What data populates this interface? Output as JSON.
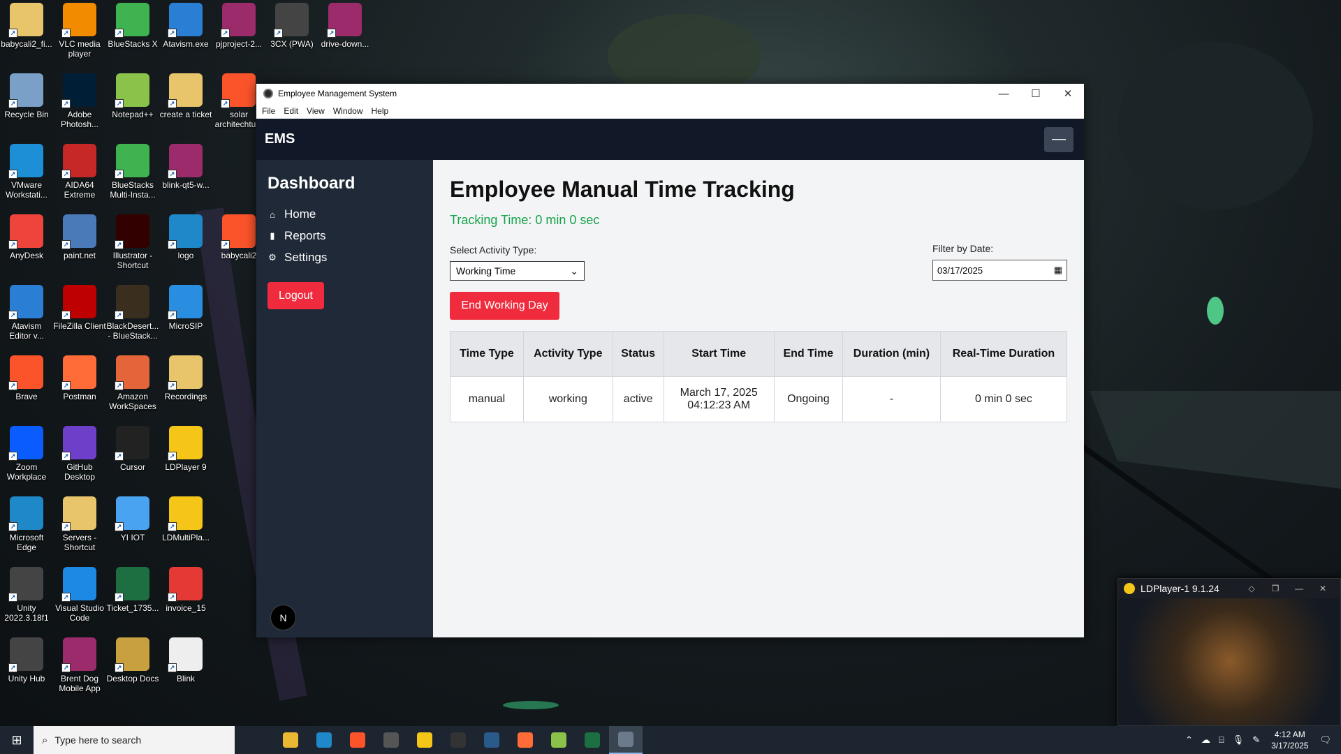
{
  "desktop": {
    "icons": [
      {
        "label": "babycali2_fi...",
        "icon": "folder-icon",
        "color": "#e8c56a"
      },
      {
        "label": "VLC media player",
        "icon": "vlc-icon",
        "color": "#f28b00"
      },
      {
        "label": "BlueStacks X",
        "icon": "bluestacks-icon",
        "color": "#3fb34f"
      },
      {
        "label": "Atavism.exe",
        "icon": "atavism-icon",
        "color": "#2a7fd4"
      },
      {
        "label": "pjproject-2...",
        "icon": "winrar-icon",
        "color": "#9c2b6b"
      },
      {
        "label": "3CX (PWA)",
        "icon": "3cx-icon",
        "color": "#444"
      },
      {
        "label": "drive-down...",
        "icon": "winrar-icon",
        "color": "#9c2b6b"
      },
      {
        "label": "Recycle Bin",
        "icon": "recycle-bin-icon",
        "color": "#7aa0c8"
      },
      {
        "label": "Adobe Photosh...",
        "icon": "photoshop-icon",
        "color": "#001e36"
      },
      {
        "label": "Notepad++",
        "icon": "notepadpp-icon",
        "color": "#8bc34a"
      },
      {
        "label": "create a ticket",
        "icon": "folder-icon",
        "color": "#e8c56a"
      },
      {
        "label": "solar architechtu...",
        "icon": "brave-icon",
        "color": "#fb542b"
      },
      {
        "label": "VMware Workstati...",
        "icon": "vmware-icon",
        "color": "#1d8fd6"
      },
      {
        "label": "AIDA64 Extreme",
        "icon": "aida64-icon",
        "color": "#c62828"
      },
      {
        "label": "BlueStacks Multi-Insta...",
        "icon": "bluestacks-icon",
        "color": "#3fb34f"
      },
      {
        "label": "blink-qt5-w...",
        "icon": "winrar-icon",
        "color": "#9c2b6b"
      },
      {
        "label": "AnyDesk",
        "icon": "anydesk-icon",
        "color": "#ef443b"
      },
      {
        "label": "paint.net",
        "icon": "paintnet-icon",
        "color": "#4a7ab8"
      },
      {
        "label": "Illustrator - Shortcut",
        "icon": "illustrator-icon",
        "color": "#330000"
      },
      {
        "label": "logo",
        "icon": "edge-icon",
        "color": "#1e88c8"
      },
      {
        "label": "babycali2",
        "icon": "brave-icon",
        "color": "#fb542b"
      },
      {
        "label": "Atavism Editor v...",
        "icon": "atavism-icon",
        "color": "#2a7fd4"
      },
      {
        "label": "FileZilla Client",
        "icon": "filezilla-icon",
        "color": "#bf0000"
      },
      {
        "label": "BlackDesert... - BlueStack...",
        "icon": "blackdesert-icon",
        "color": "#3a2e1e"
      },
      {
        "label": "MicroSIP",
        "icon": "microsip-icon",
        "color": "#2a8ee0"
      },
      {
        "label": "Brave",
        "icon": "brave-icon",
        "color": "#fb542b"
      },
      {
        "label": "Postman",
        "icon": "postman-icon",
        "color": "#ff6c37"
      },
      {
        "label": "Amazon WorkSpaces",
        "icon": "workspaces-icon",
        "color": "#e5653a"
      },
      {
        "label": "Recordings",
        "icon": "folder-icon",
        "color": "#e8c56a"
      },
      {
        "label": "Zoom Workplace",
        "icon": "zoom-icon",
        "color": "#0b5cff"
      },
      {
        "label": "GitHub Desktop",
        "icon": "github-icon",
        "color": "#6e40c9"
      },
      {
        "label": "Cursor",
        "icon": "cursor-icon",
        "color": "#222"
      },
      {
        "label": "LDPlayer 9",
        "icon": "ldplayer-icon",
        "color": "#f5c518"
      },
      {
        "label": "Microsoft Edge",
        "icon": "edge-icon",
        "color": "#1e88c8"
      },
      {
        "label": "Servers - Shortcut",
        "icon": "folder-icon",
        "color": "#e8c56a"
      },
      {
        "label": "YI IOT",
        "icon": "yiiot-icon",
        "color": "#4aa3f0"
      },
      {
        "label": "LDMultiPla...",
        "icon": "ldmultiplayer-icon",
        "color": "#f5c518"
      },
      {
        "label": "Unity 2022.3.18f1",
        "icon": "unity-icon",
        "color": "#444"
      },
      {
        "label": "Visual Studio Code",
        "icon": "vscode-icon",
        "color": "#1e88e5"
      },
      {
        "label": "Ticket_1735...",
        "icon": "excel-icon",
        "color": "#1d6f42"
      },
      {
        "label": "invoice_15",
        "icon": "pdf-icon",
        "color": "#e53935"
      },
      {
        "label": "Unity Hub",
        "icon": "unity-icon",
        "color": "#444"
      },
      {
        "label": "Brent Dog Mobile App",
        "icon": "winrar-icon",
        "color": "#9c2b6b"
      },
      {
        "label": "Desktop Docs",
        "icon": "winrar-icon",
        "color": "#c8a040"
      },
      {
        "label": "Blink",
        "icon": "file-icon",
        "color": "#eeeeee"
      }
    ]
  },
  "window": {
    "title": "Employee Management System",
    "menu": [
      "File",
      "Edit",
      "View",
      "Window",
      "Help"
    ],
    "minimize": "—",
    "maximize": "☐",
    "close": "✕"
  },
  "app": {
    "brand": "EMS",
    "menu_toggle": "—",
    "sidebar": {
      "title": "Dashboard",
      "items": [
        {
          "label": "Home",
          "icon": "home-icon",
          "glyph": "⌂"
        },
        {
          "label": "Reports",
          "icon": "reports-icon",
          "glyph": "▮"
        },
        {
          "label": "Settings",
          "icon": "gear-icon",
          "glyph": "⚙"
        }
      ],
      "logout": "Logout",
      "badge": "N"
    },
    "main": {
      "title": "Employee Manual Time Tracking",
      "tracking": "Tracking Time: 0 min 0 sec",
      "activity_label": "Select Activity Type:",
      "activity_value": "Working Time",
      "date_label": "Filter by Date:",
      "date_value": "03/17/2025",
      "end_button": "End Working Day",
      "table": {
        "headers": [
          "Time Type",
          "Activity Type",
          "Status",
          "Start Time",
          "End Time",
          "Duration (min)",
          "Real-Time Duration"
        ],
        "rows": [
          [
            "manual",
            "working",
            "active",
            "March 17, 2025 04:12:23 AM",
            "Ongoing",
            "-",
            "0 min 0 sec"
          ]
        ]
      }
    }
  },
  "ldplayer": {
    "title": "LDPlayer-1 9.1.24"
  },
  "taskbar": {
    "search_placeholder": "Type here to search",
    "time": "4:12 AM",
    "date": "3/17/2025",
    "apps": [
      {
        "name": "task-view-icon",
        "color": "#1c2530"
      },
      {
        "name": "file-explorer-icon",
        "color": "#e8b931"
      },
      {
        "name": "edge-icon",
        "color": "#1e88c8"
      },
      {
        "name": "brave-icon",
        "color": "#fb542b"
      },
      {
        "name": "3cx-icon",
        "color": "#555"
      },
      {
        "name": "ldplayer-icon",
        "color": "#f5c518"
      },
      {
        "name": "cursor-icon",
        "color": "#333"
      },
      {
        "name": "atavism-icon",
        "color": "#2a5a8a"
      },
      {
        "name": "postman-icon",
        "color": "#ff6c37"
      },
      {
        "name": "notepadpp-icon",
        "color": "#8bc34a"
      },
      {
        "name": "excel-icon",
        "color": "#1d6f42"
      },
      {
        "name": "electron-icon",
        "color": "#6b7b8c"
      }
    ]
  }
}
